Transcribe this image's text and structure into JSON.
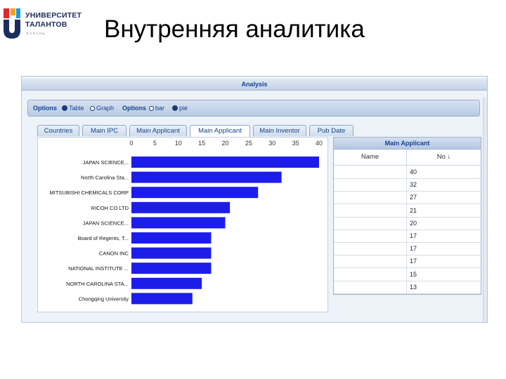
{
  "slide": {
    "logo_line1": "УНИВЕРСИТЕТ",
    "logo_line2": "ТАЛАНТОВ",
    "logo_line3": "КАЗАНЬ",
    "title": "Внутренняя аналитика"
  },
  "app": {
    "title": "Analysis",
    "options_bar": {
      "label1": "Options",
      "radio_table": "Table",
      "radio_graph": "Graph",
      "label2": "Options",
      "radio_bar": "bar",
      "radio_pie": "pie"
    },
    "tabs": [
      "Countries",
      "Main IPC",
      "Main Applicant",
      "Main Applicant",
      "Main Inventor",
      "Pub Date"
    ],
    "active_tab": 3,
    "grid": {
      "title": "Main Applicant",
      "col_name": "Name",
      "col_no": "No ↓",
      "values": [
        "40",
        "32",
        "27",
        "21",
        "20",
        "17",
        "17",
        "17",
        "15",
        "13"
      ]
    }
  },
  "chart_data": {
    "type": "bar",
    "orientation": "horizontal",
    "categories": [
      "JAPAN SCIENCE...",
      "North Carolina Sta...",
      "MITSUBISHI CHEMICALS CORP",
      "RICOH CO LTD",
      "JAPAN SCIENCE...",
      "Board of Regents, T...",
      "CANON INC",
      "NATIONAL INSTITUTE ...",
      "NORTH CAROLINA STA...",
      "Chongqing University"
    ],
    "values": [
      40,
      32,
      27,
      21,
      20,
      17,
      17,
      17,
      15,
      13
    ],
    "xticks": [
      "0",
      "5",
      "10",
      "15",
      "20",
      "25",
      "30",
      "35",
      "40"
    ],
    "xlim": [
      0,
      40
    ],
    "bar_color": "#1d1dea",
    "grid": false
  }
}
